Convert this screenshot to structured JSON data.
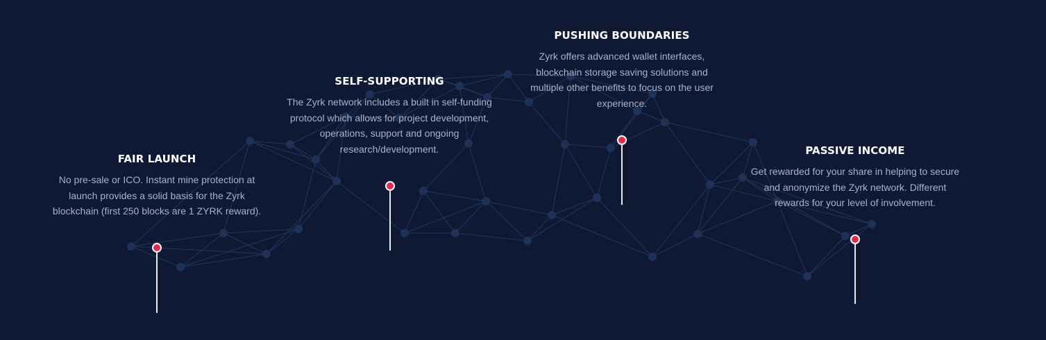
{
  "colors": {
    "background": "#0f1933",
    "network_line": "#22365f",
    "network_node": "#1e3158",
    "pin_fill": "#e8294e",
    "pin_stem": "#e9ecf3",
    "heading": "#ffffff",
    "body_text": "#a9b2c8"
  },
  "features": [
    {
      "title": "FAIR LAUNCH",
      "lines": [
        "No pre-sale or ICO. Instant mine protection at",
        "launch provides a solid basis for the Zyrk",
        "blockchain (first 250 blocks are 1 ZYRK reward)."
      ]
    },
    {
      "title": "SELF-SUPPORTING",
      "lines": [
        "The Zyrk network includes a built in self-funding",
        "protocol which allows for project development,",
        "operations, support and ongoing",
        "research/development."
      ]
    },
    {
      "title": "PUSHING BOUNDARIES",
      "lines": [
        "Zyrk offers advanced wallet interfaces,",
        "blockchain storage saving solutions and",
        "multiple other benefits to focus on the user",
        "experience."
      ]
    },
    {
      "title": "PASSIVE INCOME",
      "lines": [
        "Get rewarded for your share in helping to secure",
        "and anonymize the Zyrk network. Different",
        "rewards for your level of involvement."
      ]
    }
  ]
}
